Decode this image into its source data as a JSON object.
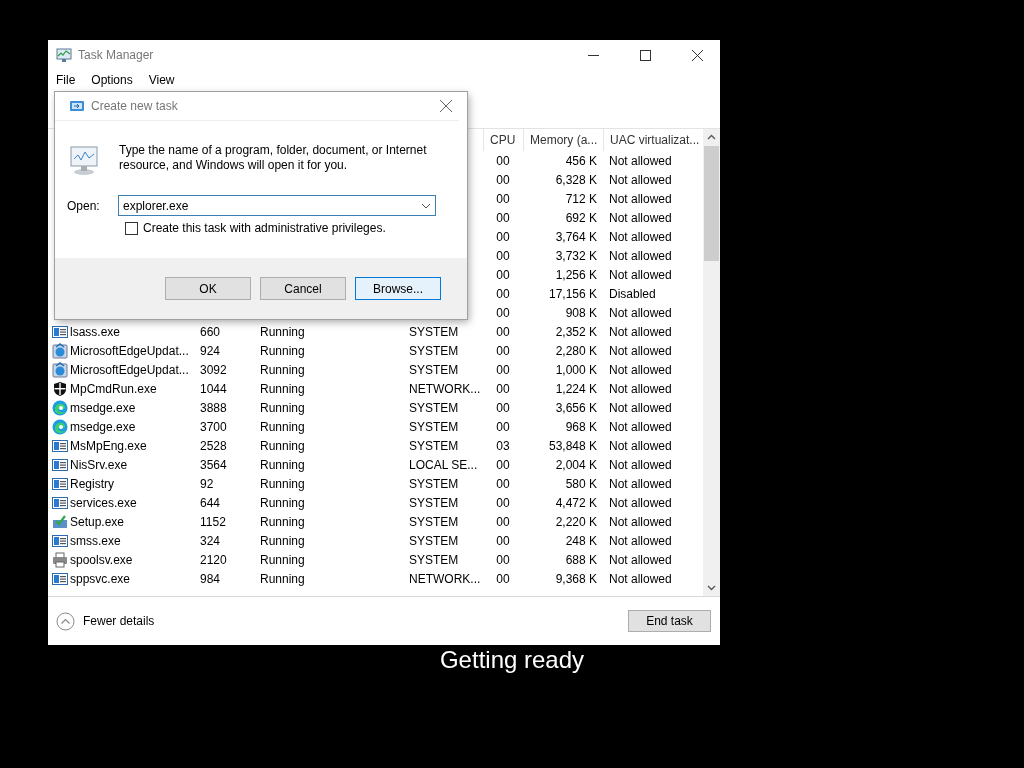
{
  "window": {
    "title": "Task Manager"
  },
  "menu": [
    "File",
    "Options",
    "View"
  ],
  "table": {
    "columns": [
      {
        "label": "CPU"
      },
      {
        "label": "Memory (a..."
      },
      {
        "label": "UAC virtualizat..."
      }
    ],
    "rows": [
      {
        "cpu": "00",
        "memory": "456 K",
        "uac": "Not allowed"
      },
      {
        "cpu": "00",
        "memory": "6,328 K",
        "uac": "Not allowed"
      },
      {
        "cpu": "00",
        "memory": "712 K",
        "uac": "Not allowed"
      },
      {
        "cpu": "00",
        "memory": "692 K",
        "uac": "Not allowed"
      },
      {
        "cpu": "00",
        "memory": "3,764 K",
        "uac": "Not allowed"
      },
      {
        "cpu": "00",
        "memory": "3,732 K",
        "uac": "Not allowed"
      },
      {
        "cpu": "00",
        "memory": "1,256 K",
        "uac": "Not allowed"
      },
      {
        "cpu": "00",
        "memory": "17,156 K",
        "uac": "Disabled"
      },
      {
        "cpu": "00",
        "memory": "908 K",
        "uac": "Not allowed"
      },
      {
        "kind": "app",
        "name": "lsass.exe",
        "pid": "660",
        "status": "Running",
        "user": "SYSTEM",
        "cpu": "00",
        "memory": "2,352 K",
        "uac": "Not allowed"
      },
      {
        "kind": "updater",
        "name": "MicrosoftEdgeUpdat...",
        "pid": "924",
        "status": "Running",
        "user": "SYSTEM",
        "cpu": "00",
        "memory": "2,280 K",
        "uac": "Not allowed"
      },
      {
        "kind": "updater",
        "name": "MicrosoftEdgeUpdat...",
        "pid": "3092",
        "status": "Running",
        "user": "SYSTEM",
        "cpu": "00",
        "memory": "1,000 K",
        "uac": "Not allowed"
      },
      {
        "kind": "shield",
        "name": "MpCmdRun.exe",
        "pid": "1044",
        "status": "Running",
        "user": "NETWORK...",
        "cpu": "00",
        "memory": "1,224 K",
        "uac": "Not allowed"
      },
      {
        "kind": "browser",
        "name": "msedge.exe",
        "pid": "3888",
        "status": "Running",
        "user": "SYSTEM",
        "cpu": "00",
        "memory": "3,656 K",
        "uac": "Not allowed"
      },
      {
        "kind": "browser",
        "name": "msedge.exe",
        "pid": "3700",
        "status": "Running",
        "user": "SYSTEM",
        "cpu": "00",
        "memory": "968 K",
        "uac": "Not allowed"
      },
      {
        "kind": "app",
        "name": "MsMpEng.exe",
        "pid": "2528",
        "status": "Running",
        "user": "SYSTEM",
        "cpu": "03",
        "memory": "53,848 K",
        "uac": "Not allowed"
      },
      {
        "kind": "app",
        "name": "NisSrv.exe",
        "pid": "3564",
        "status": "Running",
        "user": "LOCAL SE...",
        "cpu": "00",
        "memory": "2,004 K",
        "uac": "Not allowed"
      },
      {
        "kind": "app",
        "name": "Registry",
        "pid": "92",
        "status": "Running",
        "user": "SYSTEM",
        "cpu": "00",
        "memory": "580 K",
        "uac": "Not allowed"
      },
      {
        "kind": "app",
        "name": "services.exe",
        "pid": "644",
        "status": "Running",
        "user": "SYSTEM",
        "cpu": "00",
        "memory": "4,472 K",
        "uac": "Not allowed"
      },
      {
        "kind": "installer",
        "name": "Setup.exe",
        "pid": "1152",
        "status": "Running",
        "user": "SYSTEM",
        "cpu": "00",
        "memory": "2,220 K",
        "uac": "Not allowed"
      },
      {
        "kind": "app",
        "name": "smss.exe",
        "pid": "324",
        "status": "Running",
        "user": "SYSTEM",
        "cpu": "00",
        "memory": "248 K",
        "uac": "Not allowed"
      },
      {
        "kind": "printer",
        "name": "spoolsv.exe",
        "pid": "2120",
        "status": "Running",
        "user": "SYSTEM",
        "cpu": "00",
        "memory": "688 K",
        "uac": "Not allowed"
      },
      {
        "kind": "app",
        "name": "sppsvc.exe",
        "pid": "984",
        "status": "Running",
        "user": "NETWORK...",
        "cpu": "00",
        "memory": "9,368 K",
        "uac": "Not allowed"
      }
    ]
  },
  "footer": {
    "details_toggle": "Fewer details",
    "end_task": "End task"
  },
  "dialog": {
    "title": "Create new task",
    "message": "Type the name of a program, folder, document, or Internet resource, and Windows will open it for you.",
    "open_label": "Open:",
    "open_value": "explorer.exe",
    "admin_checkbox": {
      "label": "Create this task with administrative privileges.",
      "checked": false
    },
    "buttons": [
      {
        "label": "OK",
        "selected": false
      },
      {
        "label": "Cancel",
        "selected": false
      },
      {
        "label": "Browse...",
        "selected": true
      }
    ]
  },
  "background_text": "Getting ready"
}
